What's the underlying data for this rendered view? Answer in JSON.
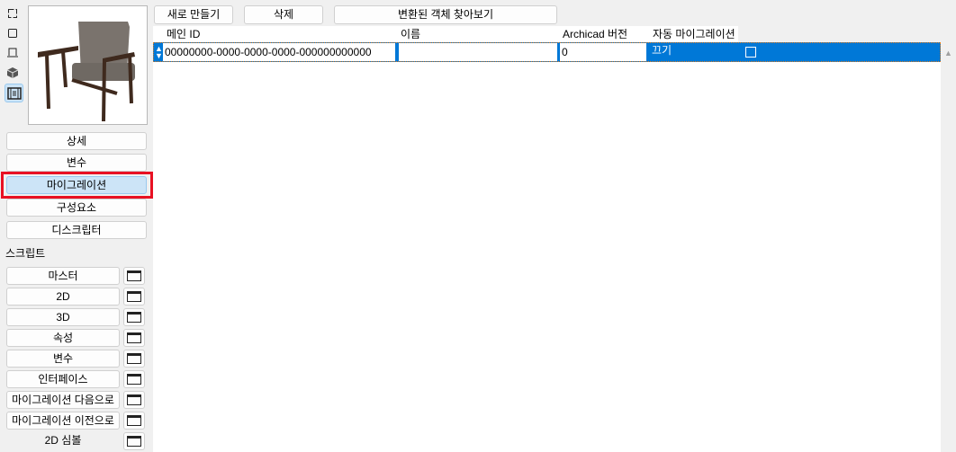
{
  "view_icons": [
    "floor-plan-icon",
    "section-icon",
    "elevation-icon",
    "3d-icon",
    "migration-icon"
  ],
  "sidebar": {
    "nav": [
      {
        "label": "상세"
      },
      {
        "label": "변수"
      },
      {
        "label": "마이그레이션",
        "selected": true
      },
      {
        "label": "구성요소"
      },
      {
        "label": "디스크립터"
      }
    ],
    "scripts_label": "스크립트",
    "scripts": [
      {
        "label": "마스터"
      },
      {
        "label": "2D"
      },
      {
        "label": "3D"
      },
      {
        "label": "속성"
      },
      {
        "label": "변수"
      },
      {
        "label": "인터페이스"
      },
      {
        "label": "마이그레이션 다음으로"
      },
      {
        "label": "마이그레이션 이전으로"
      },
      {
        "label": "2D 심볼"
      }
    ]
  },
  "toolbar": {
    "new_label": "새로 만들기",
    "delete_label": "삭제",
    "browse_label": "변환된 객체 찾아보기"
  },
  "table": {
    "columns": [
      "메인 ID",
      "이름",
      "Archicad 버전",
      "자동 마이그레이션"
    ],
    "rows": [
      {
        "main_id": "00000000-0000-0000-0000-000000000000",
        "name": "",
        "version": "0",
        "auto_migration": "끄기",
        "checked": false
      }
    ]
  },
  "colors": {
    "selection": "#0078d7",
    "highlight_border": "#e81123",
    "selected_button": "#cce4f7"
  }
}
